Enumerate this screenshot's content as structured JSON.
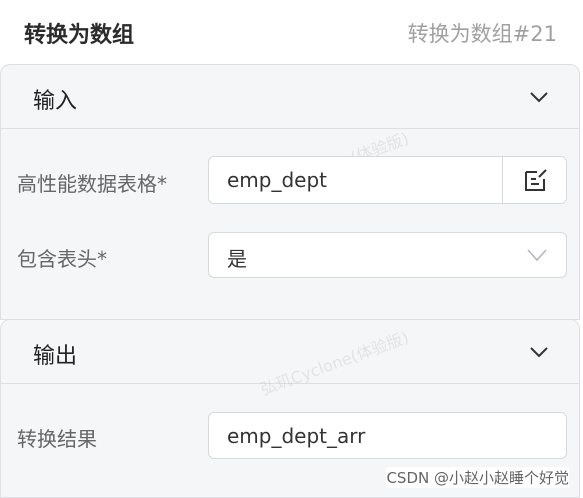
{
  "header": {
    "title": "转换为数组",
    "node_id": "转换为数组#21"
  },
  "input_section": {
    "title": "输入",
    "table_field": {
      "label": "高性能数据表格*",
      "value": "emp_dept"
    },
    "header_field": {
      "label": "包含表头*",
      "value": "是"
    }
  },
  "output_section": {
    "title": "输出",
    "result_field": {
      "label": "转换结果",
      "value": "emp_dept_arr"
    }
  },
  "watermark": "弘玑Cyclone(体验版)",
  "credit": "CSDN @小赵小赵睡个好觉",
  "colors": {
    "panel_bg": "#f5f6f7",
    "border": "#dcdfe3",
    "muted_text": "#a0a0a0"
  }
}
